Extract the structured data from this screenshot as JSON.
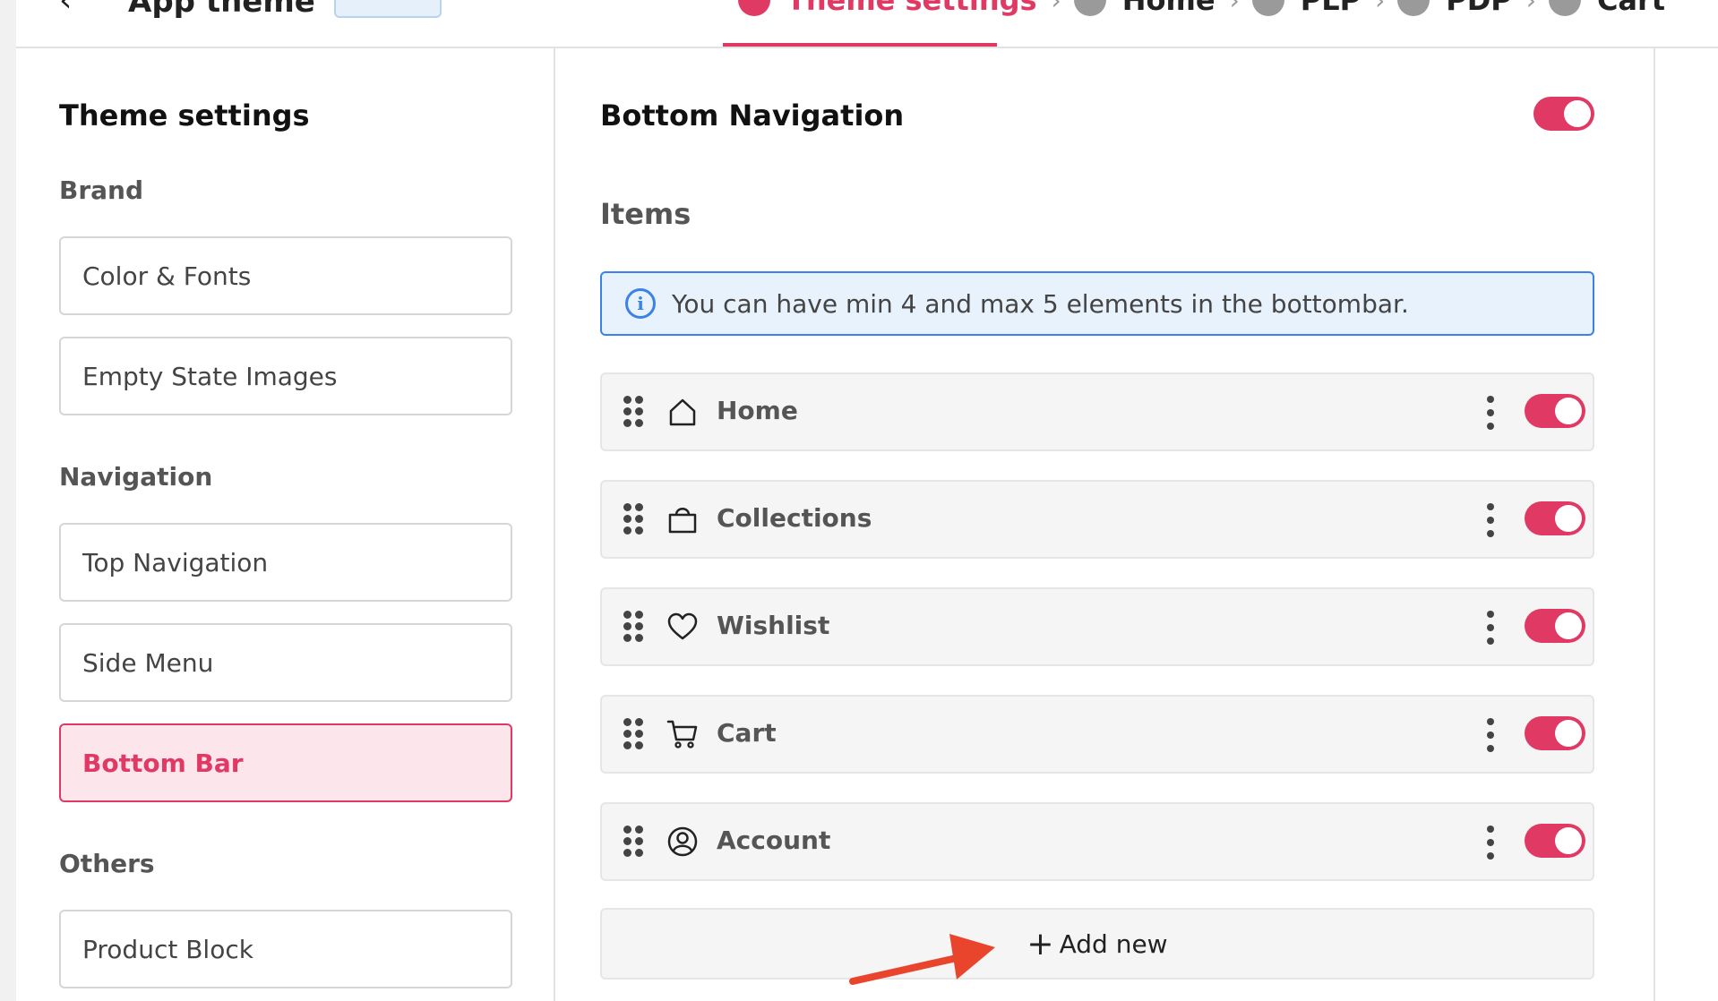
{
  "header": {
    "app_title": "App theme",
    "steps": [
      {
        "label": "Theme settings",
        "active": true
      },
      {
        "label": "Home",
        "active": false
      },
      {
        "label": "PLP",
        "active": false
      },
      {
        "label": "PDP",
        "active": false
      },
      {
        "label": "Cart",
        "active": false
      }
    ]
  },
  "sidebar": {
    "title": "Theme settings",
    "sections": [
      {
        "label": "Brand",
        "items": [
          "Color & Fonts",
          "Empty State Images"
        ]
      },
      {
        "label": "Navigation",
        "items": [
          "Top Navigation",
          "Side Menu",
          "Bottom Bar"
        ]
      },
      {
        "label": "Others",
        "items": [
          "Product Block"
        ]
      }
    ],
    "active_item": "Bottom Bar"
  },
  "main": {
    "title": "Bottom Navigation",
    "enabled": true,
    "items_label": "Items",
    "info_text": "You can have min 4 and max 5 elements in the bottombar.",
    "nav_items": [
      {
        "label": "Home",
        "icon": "home-icon",
        "enabled": true
      },
      {
        "label": "Collections",
        "icon": "bag-icon",
        "enabled": true
      },
      {
        "label": "Wishlist",
        "icon": "heart-icon",
        "enabled": true
      },
      {
        "label": "Cart",
        "icon": "cart-icon",
        "enabled": true
      },
      {
        "label": "Account",
        "icon": "account-icon",
        "enabled": true
      }
    ],
    "add_new_label": "Add new"
  },
  "colors": {
    "accent": "#e03a64",
    "info_border": "#3b82e8",
    "info_bg": "#e8f2fd",
    "annotation_arrow": "#e8452c"
  }
}
